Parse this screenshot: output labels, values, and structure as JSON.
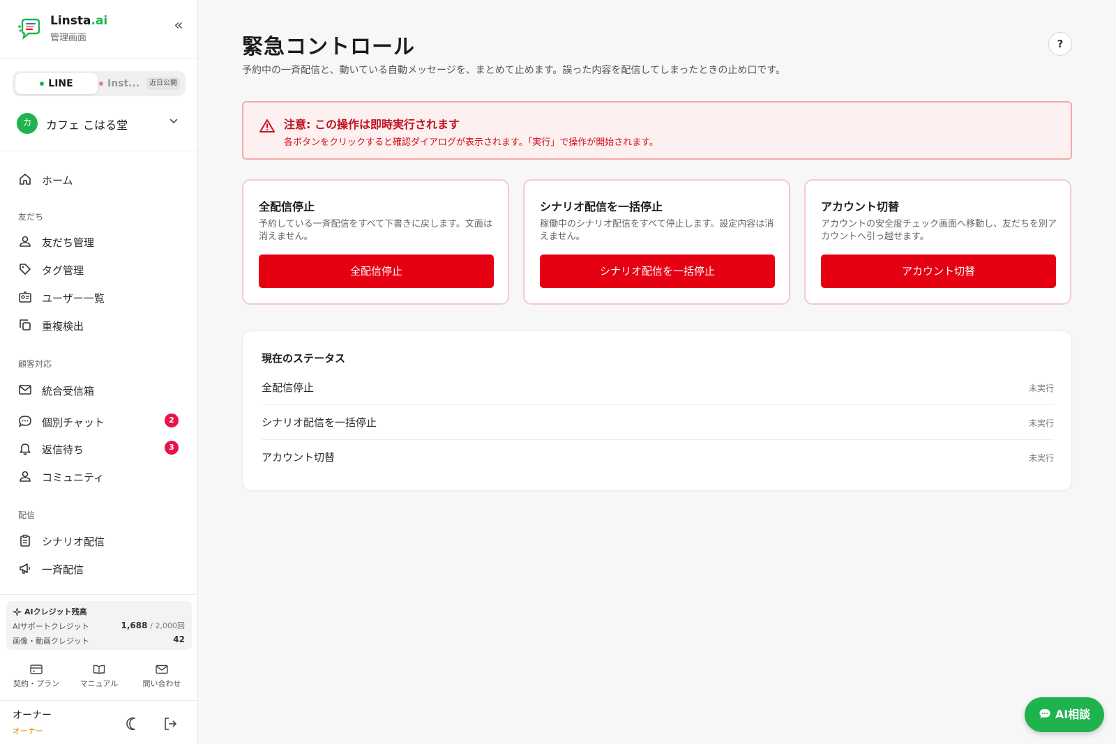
{
  "brand": {
    "name_main": "Linsta",
    "name_accent": ".ai",
    "subtitle": "管理画面",
    "accent_color": "#1fb34f"
  },
  "channels": {
    "line": {
      "label": "LINE",
      "dot_color": "#1fb34f"
    },
    "instagram": {
      "label": "Inst...",
      "dot_color": "#e87a9a",
      "badge": "近日公開"
    }
  },
  "account": {
    "avatar": "カ",
    "name": "カフェ こはる堂"
  },
  "nav": {
    "home": "ホーム",
    "friends_section": "友だち",
    "friends_items": [
      "友だち管理",
      "タグ管理",
      "ユーザー一覧",
      "重複検出"
    ],
    "support_section": "顧客対応",
    "inbox": "統合受信箱",
    "chat": {
      "label": "個別チャット",
      "count": "2"
    },
    "waiting": {
      "label": "返信待ち",
      "count": "3"
    },
    "community": "コミュニティ",
    "delivery_section": "配信",
    "scenario": "シナリオ配信",
    "broadcast": "一斉配信"
  },
  "credits": {
    "title": "AIクレジット残高",
    "support_label": "AIサポートクレジット",
    "support_value": "1,688",
    "support_total": "/ 2,000回",
    "media_label": "画像・動画クレジット",
    "media_value": "42"
  },
  "quick_links": {
    "plan": "契約・プラン",
    "manual": "マニュアル",
    "contact": "問い合わせ"
  },
  "user": {
    "name": "オーナー",
    "role": "オーナー"
  },
  "page": {
    "title": "緊急コントロール",
    "subtitle": "予約中の一斉配信と、動いている自動メッセージを、まとめて止めます。誤った内容を配信してしまったときの止め口です。",
    "help": "?"
  },
  "alert": {
    "title": "注意: この操作は即時実行されます",
    "text": "各ボタンをクリックすると確認ダイアログが表示されます。「実行」で操作が開始されます。"
  },
  "cards": [
    {
      "title": "全配信停止",
      "desc": "予約している一斉配信をすべて下書きに戻します。文面は消えません。",
      "button": "全配信停止"
    },
    {
      "title": "シナリオ配信を一括停止",
      "desc": "稼働中のシナリオ配信をすべて停止します。設定内容は消えません。",
      "button": "シナリオ配信を一括停止"
    },
    {
      "title": "アカウント切替",
      "desc": "アカウントの安全度チェック画面へ移動し、友だちを別アカウントへ引っ越せます。",
      "button": "アカウント切替"
    }
  ],
  "status": {
    "title": "現在のステータス",
    "rows": [
      {
        "name": "全配信停止",
        "value": "未実行"
      },
      {
        "name": "シナリオ配信を一括停止",
        "value": "未実行"
      },
      {
        "name": "アカウント切替",
        "value": "未実行"
      }
    ]
  },
  "ai_button": "AI相談",
  "colors": {
    "danger": "#e50012",
    "alert_bg": "#fdf0f0",
    "badge": "#e8134a"
  }
}
